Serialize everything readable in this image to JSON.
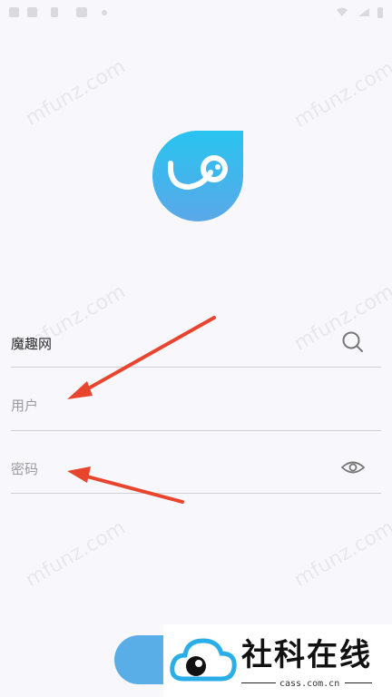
{
  "watermark_text": "mfunz.com",
  "form": {
    "site_value": "魔趣网",
    "username_placeholder": "用户",
    "password_placeholder": "密码"
  },
  "badge": {
    "brand": "社科在线",
    "site": "cass.com.cn"
  },
  "colors": {
    "logo_gradient_top": "#29c4f0",
    "logo_gradient_bottom": "#5aa8e8",
    "arrow": "#e8452f",
    "login_button": "#5aaee8"
  },
  "icons": [
    "search-icon",
    "eye-icon",
    "logo-icon",
    "cloud-logo-icon"
  ]
}
